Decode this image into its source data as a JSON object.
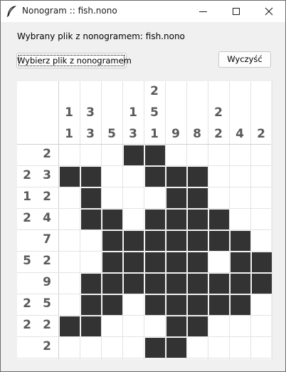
{
  "window": {
    "title": "Nonogram :: fish.nono",
    "app_icon": "feather-icon",
    "controls": [
      "minimize-icon",
      "maximize-icon",
      "close-icon"
    ]
  },
  "file_label": "Wybrany plik z nonogramem: fish.nono",
  "buttons": {
    "choose": "Wybierz plik z nonogramem",
    "clear": "Wyczyść"
  },
  "puzzle": {
    "column_clues": [
      [
        "1",
        "1"
      ],
      [
        "3",
        "3"
      ],
      [
        "5"
      ],
      [
        "1",
        "3"
      ],
      [
        "2",
        "5",
        "1"
      ],
      [
        "9"
      ],
      [
        "8"
      ],
      [
        "2",
        "2"
      ],
      [
        "4"
      ],
      [
        "2"
      ]
    ],
    "row_clues": [
      [
        "2"
      ],
      [
        "2",
        "3"
      ],
      [
        "1",
        "2"
      ],
      [
        "2",
        "4"
      ],
      [
        "7"
      ],
      [
        "5",
        "2"
      ],
      [
        "9"
      ],
      [
        "2",
        "5"
      ],
      [
        "2",
        "2"
      ],
      [
        "2"
      ]
    ],
    "grid": [
      [
        0,
        0,
        0,
        1,
        1,
        0,
        0,
        0,
        0,
        0
      ],
      [
        1,
        1,
        0,
        0,
        1,
        1,
        1,
        0,
        0,
        0
      ],
      [
        0,
        1,
        0,
        0,
        0,
        1,
        1,
        0,
        0,
        0
      ],
      [
        0,
        1,
        1,
        0,
        1,
        1,
        1,
        1,
        0,
        0
      ],
      [
        0,
        0,
        1,
        1,
        1,
        1,
        1,
        1,
        1,
        0
      ],
      [
        0,
        0,
        1,
        1,
        1,
        1,
        1,
        0,
        1,
        1
      ],
      [
        0,
        1,
        1,
        1,
        1,
        1,
        1,
        1,
        1,
        1
      ],
      [
        0,
        1,
        1,
        0,
        1,
        1,
        1,
        1,
        1,
        0
      ],
      [
        1,
        1,
        0,
        0,
        0,
        1,
        1,
        0,
        0,
        0
      ],
      [
        0,
        0,
        0,
        0,
        1,
        1,
        0,
        0,
        0,
        0
      ]
    ],
    "colors": {
      "filled": "#333333",
      "empty": "#ffffff",
      "clue_text": "#5a5a5a",
      "grid_line": "#e3e3e3"
    }
  }
}
